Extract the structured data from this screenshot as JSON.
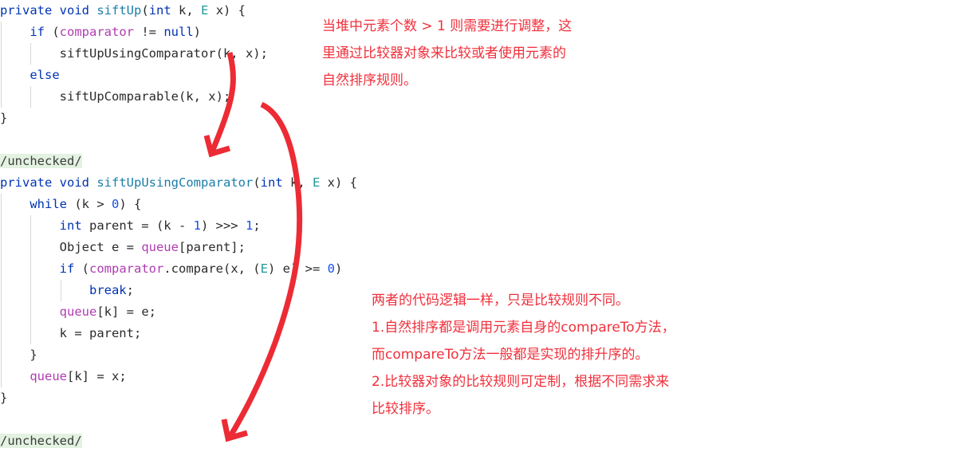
{
  "editor": {
    "language": "java",
    "lines": [
      {
        "id": "l1",
        "indent": 0,
        "tokens": [
          {
            "t": "private",
            "c": "kw"
          },
          {
            "t": " ",
            "c": "pln"
          },
          {
            "t": "void",
            "c": "kw"
          },
          {
            "t": " ",
            "c": "pln"
          },
          {
            "t": "siftUp",
            "c": "mth"
          },
          {
            "t": "(",
            "c": "pln"
          },
          {
            "t": "int",
            "c": "kw"
          },
          {
            "t": " k, ",
            "c": "pln"
          },
          {
            "t": "E",
            "c": "typ"
          },
          {
            "t": " x) {",
            "c": "pln"
          }
        ]
      },
      {
        "id": "l2",
        "indent": 1,
        "tokens": [
          {
            "t": "if",
            "c": "kw"
          },
          {
            "t": " (",
            "c": "pln"
          },
          {
            "t": "comparator",
            "c": "fld"
          },
          {
            "t": " != ",
            "c": "pln"
          },
          {
            "t": "null",
            "c": "kw"
          },
          {
            "t": ")",
            "c": "pln"
          }
        ]
      },
      {
        "id": "l3",
        "indent": 2,
        "tokens": [
          {
            "t": "siftUpUsingComparator",
            "c": "pln"
          },
          {
            "t": "(k, x);",
            "c": "pln"
          }
        ]
      },
      {
        "id": "l4",
        "indent": 1,
        "tokens": [
          {
            "t": "else",
            "c": "kw"
          }
        ]
      },
      {
        "id": "l5",
        "indent": 2,
        "tokens": [
          {
            "t": "siftUpComparable",
            "c": "pln"
          },
          {
            "t": "(k, x);",
            "c": "pln"
          }
        ]
      },
      {
        "id": "l6",
        "indent": 0,
        "tokens": [
          {
            "t": "}",
            "c": "pln"
          }
        ]
      },
      {
        "id": "l7",
        "indent": 0,
        "tokens": []
      },
      {
        "id": "l8",
        "indent": 0,
        "tokens": [
          {
            "t": "/unchecked/",
            "c": "hl"
          }
        ]
      },
      {
        "id": "l9",
        "indent": 0,
        "tokens": [
          {
            "t": "private",
            "c": "kw"
          },
          {
            "t": " ",
            "c": "pln"
          },
          {
            "t": "void",
            "c": "kw"
          },
          {
            "t": " ",
            "c": "pln"
          },
          {
            "t": "siftUpUsingComparator",
            "c": "mth"
          },
          {
            "t": "(",
            "c": "pln"
          },
          {
            "t": "int",
            "c": "kw"
          },
          {
            "t": " k, ",
            "c": "pln"
          },
          {
            "t": "E",
            "c": "typ"
          },
          {
            "t": " x) {",
            "c": "pln"
          }
        ]
      },
      {
        "id": "l10",
        "indent": 1,
        "tokens": [
          {
            "t": "while",
            "c": "kw"
          },
          {
            "t": " (k > ",
            "c": "pln"
          },
          {
            "t": "0",
            "c": "num"
          },
          {
            "t": ") {",
            "c": "pln"
          }
        ]
      },
      {
        "id": "l11",
        "indent": 2,
        "tokens": [
          {
            "t": "int",
            "c": "kw"
          },
          {
            "t": " parent = (k - ",
            "c": "pln"
          },
          {
            "t": "1",
            "c": "num"
          },
          {
            "t": ") >>> ",
            "c": "pln"
          },
          {
            "t": "1",
            "c": "num"
          },
          {
            "t": ";",
            "c": "pln"
          }
        ]
      },
      {
        "id": "l12",
        "indent": 2,
        "tokens": [
          {
            "t": "Object e = ",
            "c": "pln"
          },
          {
            "t": "queue",
            "c": "fld"
          },
          {
            "t": "[parent];",
            "c": "pln"
          }
        ]
      },
      {
        "id": "l13",
        "indent": 2,
        "tokens": [
          {
            "t": "if",
            "c": "kw"
          },
          {
            "t": " (",
            "c": "pln"
          },
          {
            "t": "comparator",
            "c": "fld"
          },
          {
            "t": ".compare(x, (",
            "c": "pln"
          },
          {
            "t": "E",
            "c": "typ"
          },
          {
            "t": ") e) >= ",
            "c": "pln"
          },
          {
            "t": "0",
            "c": "num"
          },
          {
            "t": ")",
            "c": "pln"
          }
        ]
      },
      {
        "id": "l14",
        "indent": 3,
        "tokens": [
          {
            "t": "break",
            "c": "kw"
          },
          {
            "t": ";",
            "c": "pln"
          }
        ]
      },
      {
        "id": "l15",
        "indent": 2,
        "tokens": [
          {
            "t": "queue",
            "c": "fld"
          },
          {
            "t": "[k] = e;",
            "c": "pln"
          }
        ]
      },
      {
        "id": "l16",
        "indent": 2,
        "tokens": [
          {
            "t": "k = parent;",
            "c": "pln"
          }
        ]
      },
      {
        "id": "l17",
        "indent": 1,
        "tokens": [
          {
            "t": "}",
            "c": "pln"
          }
        ]
      },
      {
        "id": "l18",
        "indent": 1,
        "tokens": [
          {
            "t": "queue",
            "c": "fld"
          },
          {
            "t": "[k] = x;",
            "c": "pln"
          }
        ]
      },
      {
        "id": "l19",
        "indent": 0,
        "tokens": [
          {
            "t": "}",
            "c": "pln"
          }
        ]
      },
      {
        "id": "l20",
        "indent": 0,
        "tokens": []
      },
      {
        "id": "l21",
        "indent": 0,
        "tokens": [
          {
            "t": "/unchecked/",
            "c": "hl"
          }
        ]
      }
    ],
    "plain_text": "private void siftUp(int k, E x) {\n    if (comparator != null)\n        siftUpUsingComparator(k, x);\n    else\n        siftUpComparable(k, x);\n}\n\n/unchecked/\nprivate void siftUpUsingComparator(int k, E x) {\n    while (k > 0) {\n        int parent = (k - 1) >>> 1;\n        Object e = queue[parent];\n        if (comparator.compare(x, (E) e) >= 0)\n            break;\n        queue[k] = e;\n        k = parent;\n    }\n    queue[k] = x;\n}\n\n/unchecked/"
  },
  "annotations": {
    "color": "#f0303c",
    "top_note": {
      "lines": [
        "当堆中元素个数 > 1 则需要进行调整，这",
        "里通过比较器对象来比较或者使用元素的",
        "自然排序规则。"
      ]
    },
    "bottom_note": {
      "lines": [
        "两者的代码逻辑一样，只是比较规则不同。",
        "1.自然排序都是调用元素自身的compareTo方法，",
        "而compareTo方法一般都是实现的排升序的。",
        "2.比较器对象的比较规则可定制，根据不同需求来",
        "比较排序。"
      ]
    },
    "arrows": [
      {
        "id": "arrow-to-sift-up-using-comparator",
        "label": "curved arrow from siftUpUsingComparator call down to the method definition"
      },
      {
        "id": "arrow-to-sift-up-comparable",
        "label": "long curved arrow from siftUpComparable call down to the lower unchecked block"
      }
    ]
  },
  "theme": {
    "background": "#ffffff",
    "keyword": "#0033b3",
    "number": "#1750eb",
    "method": "#1b7ea8",
    "type": "#20999d",
    "field": "#b03cb0",
    "plain": "#2b2b2b",
    "highlight_bg": "#e3f2e1",
    "indent_guide": "#d8d8d8"
  }
}
